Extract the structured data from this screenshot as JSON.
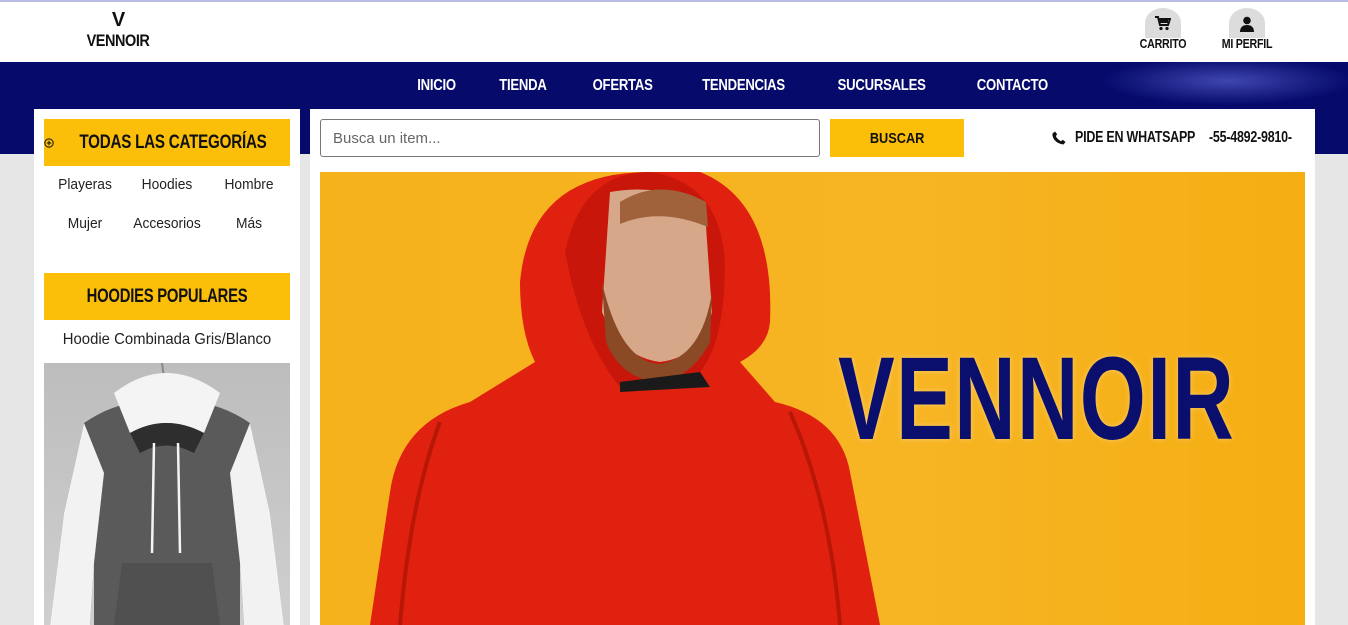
{
  "app": {
    "logo_mark": "V",
    "logo_name": "VENNOIR",
    "accent_color": "#fbbf0a",
    "nav_color": "#050a6b"
  },
  "header": {
    "cart_label": "CARRITO",
    "profile_label": "MI PERFIL"
  },
  "nav": {
    "items": [
      "INICIO",
      "TIENDA",
      "OFERTAS",
      "TENDENCIAS",
      "SUCURSALES",
      "CONTACTO"
    ]
  },
  "sidebar": {
    "all_categories_label": "TODAS LAS CATEGORÍAS",
    "categories": [
      "Playeras",
      "Hoodies",
      "Hombre",
      "Mujer",
      "Accesorios",
      "Más"
    ],
    "popular_title": "HOODIES POPULARES",
    "product_name": "Hoodie Combinada Gris/Blanco"
  },
  "search": {
    "placeholder": "Busca un item...",
    "button_label": "BUSCAR"
  },
  "whatsapp": {
    "label": "PIDE EN WHATSAPP",
    "number": "-55-4892-9810-"
  },
  "banner": {
    "brand_text": "VENNOIR"
  }
}
